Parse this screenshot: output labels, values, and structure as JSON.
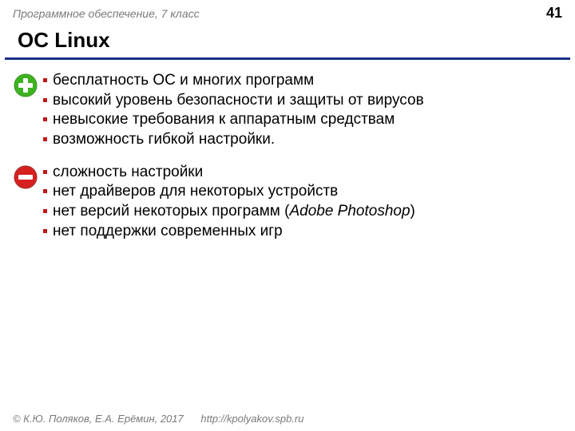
{
  "header": {
    "label": "Программное обеспечение, 7 класс",
    "page": "41"
  },
  "title": "ОС Linux",
  "pros": [
    "бесплатность ОС и многих программ",
    "высокий уровень безопасности и защиты от вирусов",
    "невысокие требования к аппаратным средствам",
    "возможность гибкой настройки."
  ],
  "cons": [
    "сложность настройки",
    "нет драйверов для некоторых устройств",
    "",
    "нет поддержки современных игр"
  ],
  "cons_special": {
    "prefix": "нет версий некоторых программ (",
    "italic": "Adobe Photoshop",
    "suffix": ")"
  },
  "footer": {
    "copyright": "© К.Ю. Поляков, Е.А. Ерёмин, 2017",
    "link": "http://kpolyakov.spb.ru"
  }
}
